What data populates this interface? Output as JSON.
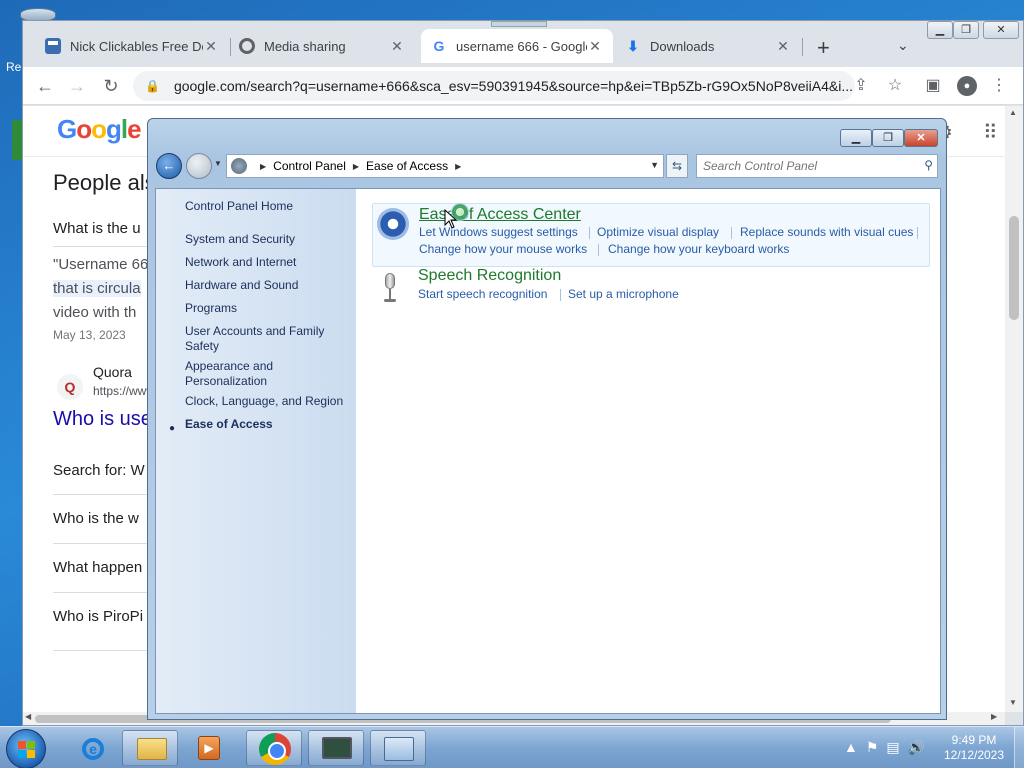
{
  "desktop": {
    "label_fragment": "Re"
  },
  "browser": {
    "tabs": [
      {
        "title": "Nick Clickables Free Do",
        "favicon": "nc-favicon"
      },
      {
        "title": "Media sharing",
        "favicon": "globe-icon"
      },
      {
        "title": "username 666 - Google",
        "favicon": "google-g-icon"
      },
      {
        "title": "Downloads",
        "favicon": "download-icon"
      }
    ],
    "new_tab": "+",
    "url": "google.com/search?q=username+666&sca_esv=590391945&source=hp&ei=TBp5Zb-rG9Ox5NoP8veiiA4&i..."
  },
  "google": {
    "logo": [
      "G",
      "o",
      "o",
      "g",
      "l",
      "e"
    ],
    "people_also_ask": "People als",
    "q1": "What is the u",
    "snippet1": "\"Username 66",
    "snippet2": "that is circula",
    "snippet3": "video with th",
    "date": "May 13, 2023",
    "source_name": "Quora",
    "source_url": "https://www",
    "result_title": "Who is use",
    "search_for": "Search for: W",
    "q2": "Who is the w",
    "q3": "What happen",
    "q4": "Who is PiroPi"
  },
  "control_panel": {
    "breadcrumb": [
      "Control Panel",
      "Ease of Access"
    ],
    "search_placeholder": "Search Control Panel",
    "nav": {
      "home": "Control Panel Home",
      "items": [
        "System and Security",
        "Network and Internet",
        "Hardware and Sound",
        "Programs",
        "User Accounts and Family Safety",
        "Appearance and Personalization",
        "Clock, Language, and Region"
      ],
      "current": "Ease of Access"
    },
    "categories": [
      {
        "title": "Ease of Access Center",
        "links": [
          "Let Windows suggest settings",
          "Optimize visual display",
          "Replace sounds with visual cues",
          "Change how your mouse works",
          "Change how your keyboard works"
        ]
      },
      {
        "title": "Speech Recognition",
        "links": [
          "Start speech recognition",
          "Set up a microphone"
        ]
      }
    ]
  },
  "taskbar": {
    "time": "9:49 PM",
    "date": "12/12/2023"
  }
}
